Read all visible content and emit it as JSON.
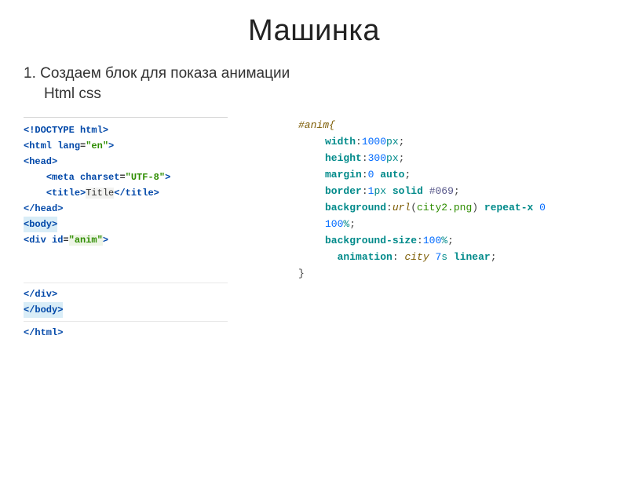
{
  "title": "Машинка",
  "subtitle": "1. Создаем блок для показа анимации",
  "labels_line": "Html   css",
  "html_code": {
    "l1_a": "<!DOCTYPE ",
    "l1_b": "html",
    "l1_c": ">",
    "l2_a": "<html ",
    "l2_attr": "lang",
    "l2_eq": "=",
    "l2_val": "\"en\"",
    "l2_c": ">",
    "l3": "<head>",
    "l4_a": "<meta ",
    "l4_attr": "charset",
    "l4_eq": "=",
    "l4_val": "\"UTF-8\"",
    "l4_c": ">",
    "l5_a": "<title>",
    "l5_txt": "Title",
    "l5_b": "</title>",
    "l6": "</head>",
    "l7": "<body>",
    "l8_a": "<div ",
    "l8_attr": "id",
    "l8_eq": "=",
    "l8_val": "\"anim\"",
    "l8_c": ">",
    "l9": "</div>",
    "l10": "</body>",
    "l11": "</html>"
  },
  "css_code": {
    "r0": "#anim{",
    "r1_prop": "width",
    "r1_punc": ":",
    "r1_num": "1000",
    "r1_unit": "px",
    "r1_end": ";",
    "r2_prop": "height",
    "r2_punc": ":",
    "r2_num": "300",
    "r2_unit": "px",
    "r2_end": ";",
    "r3_prop": "margin",
    "r3_punc": ":",
    "r3_num": "0",
    "r3_sp": " ",
    "r3_kw": "auto",
    "r3_end": ";",
    "r4_prop": "border",
    "r4_punc": ":",
    "r4_num": "1",
    "r4_unit": "px",
    "r4_sp": " ",
    "r4_kw": "solid",
    "r4_sp2": " ",
    "r4_hex": "#069",
    "r4_end": ";",
    "r5_prop": "background",
    "r5_punc": ":",
    "r5_fn": "url",
    "r5_po": "(",
    "r5_str": "city2.png",
    "r5_pc": ")",
    "r5_sp": " ",
    "r5_kw": "repeat-x",
    "r5_sp2": " ",
    "r5_n1": "0",
    "r5_sp3": " ",
    "r5_n2": "100",
    "r5_pct": "%",
    "r5_end": ";",
    "r6_prop": "background-size",
    "r6_punc": ":",
    "r6_num": "100",
    "r6_pct": "%",
    "r6_end": ";",
    "r7_prop": "animation",
    "r7_punc": ": ",
    "r7_name": "city",
    "r7_sp": " ",
    "r7_num": "7",
    "r7_unit": "s",
    "r7_sp2": " ",
    "r7_kw": "linear",
    "r7_end": ";",
    "r8": "}"
  }
}
